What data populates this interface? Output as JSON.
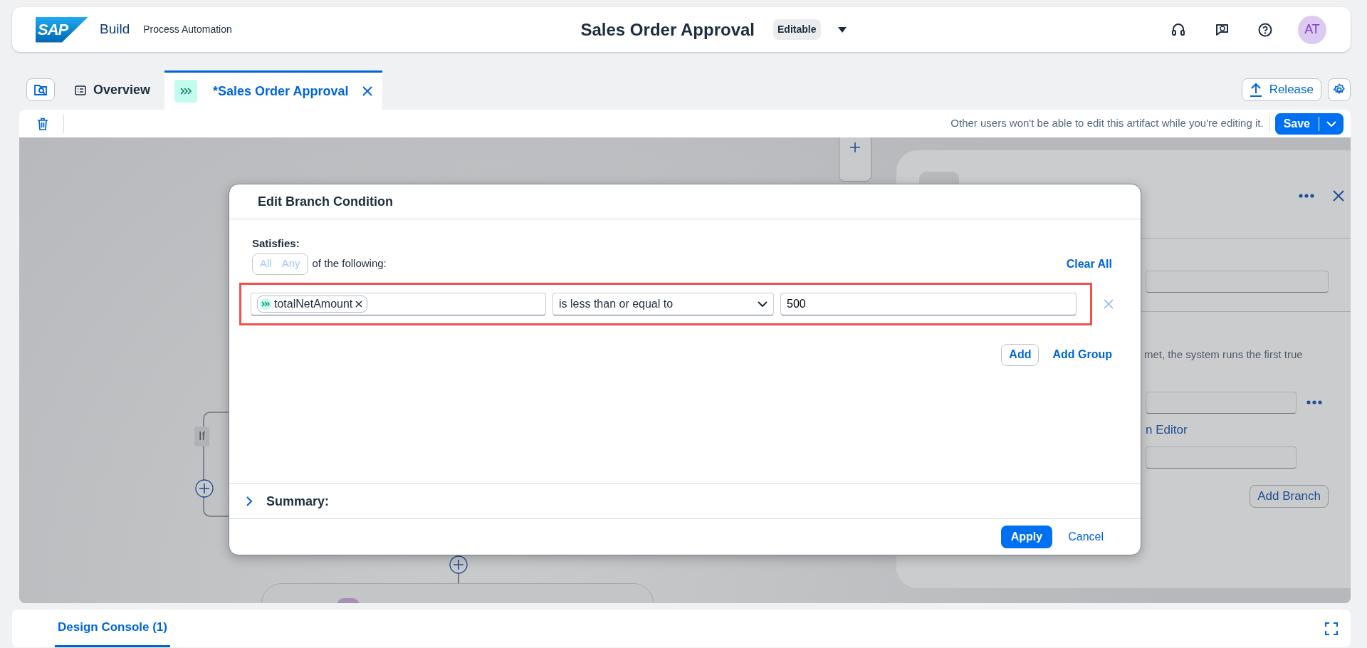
{
  "shell": {
    "logo_text": "SAP",
    "product": "Build",
    "subtitle": "Process Automation",
    "title": "Sales Order Approval",
    "status_badge": "Editable",
    "avatar_initials": "AT"
  },
  "tabs": [
    {
      "kind": "overview",
      "label": "Overview",
      "selected": false
    },
    {
      "kind": "process",
      "label": "*Sales Order Approval",
      "selected": true
    }
  ],
  "header_actions": {
    "release": "Release"
  },
  "toolbar": {
    "notice": "Other users won't be able to edit this artifact while you're editing it.",
    "save": "Save"
  },
  "canvas": {
    "branch_label": "If"
  },
  "side_panel": {
    "description": "met, the system runs the first true",
    "link": "n Editor",
    "add_branch": "Add Branch"
  },
  "dialog": {
    "title": "Edit Branch Condition",
    "satisfies_label": "Satisfies:",
    "match_options": [
      {
        "label": "All",
        "selected": false
      },
      {
        "label": "Any",
        "selected": false
      }
    ],
    "following_text": "of the following:",
    "clear_all": "Clear All",
    "conditions": [
      {
        "variable": "totalNetAmount",
        "operator": "is less than or equal to",
        "value": "500",
        "highlighted": true
      }
    ],
    "add": "Add",
    "add_group": "Add Group",
    "summary_label": "Summary:",
    "summary_expanded": false,
    "apply": "Apply",
    "cancel": "Cancel"
  },
  "bottom_panel": {
    "tabs": [
      {
        "label": "Design Console (1)",
        "selected": true
      }
    ]
  }
}
